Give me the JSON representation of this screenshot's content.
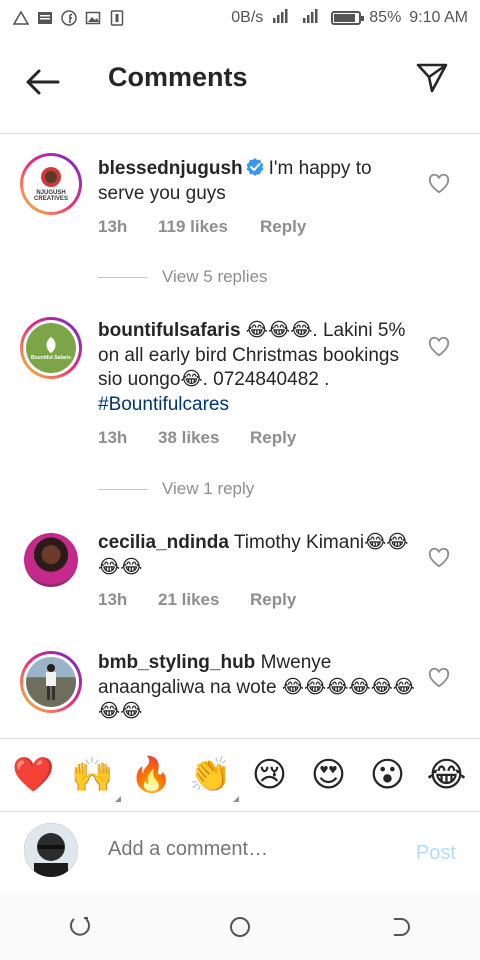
{
  "status_bar": {
    "network_speed": "0B/s",
    "battery": "85%",
    "battery_level": 0.85,
    "time": "9:10 AM",
    "icons": [
      "alert-triangle-icon",
      "news-icon",
      "facebook-icon",
      "gallery-icon",
      "sim-icon",
      "wifi-icon",
      "signal-icon",
      "battery-icon"
    ]
  },
  "header": {
    "title": "Comments",
    "back_icon": "back-arrow-icon",
    "send_icon": "send-icon"
  },
  "comments": [
    {
      "username": "blessednjugush",
      "verified": true,
      "text": "I'm happy to serve you guys",
      "time": "13h",
      "likes": "119 likes",
      "reply": "Reply",
      "view_replies": "View 5 replies",
      "avatar_label": "NJUGUSH CREATIVES"
    },
    {
      "username": "bountifulsafaris",
      "text_before": "😂😂😂. Lakini 5% on all early bird Christmas bookings sio uongo😂. 0724840482 . ",
      "hashtag": "#Bountifulcares",
      "time": "13h",
      "likes": "38 likes",
      "reply": "Reply",
      "view_replies": "View 1 reply",
      "avatar_label": "Bountiful Safaris"
    },
    {
      "username": "cecilia_ndinda",
      "text": "Timothy Kimani😂😂😂😂",
      "time": "13h",
      "likes": "21 likes",
      "reply": "Reply"
    },
    {
      "username": "bmb_styling_hub",
      "text": "Mwenye anaangaliwa na wote 😂😂😂😂😂😂😂😂"
    }
  ],
  "emoji_bar": [
    "❤️",
    "🙌",
    "🔥",
    "👏",
    "😢",
    "😍",
    "😮",
    "😂"
  ],
  "composer": {
    "placeholder": "Add a comment…",
    "post_label": "Post"
  },
  "colors": {
    "text": "#262626",
    "meta": "#8e8e8e",
    "verified": "#3897f0",
    "hashtag": "#00376b",
    "post_disabled": "#b3dbff"
  }
}
